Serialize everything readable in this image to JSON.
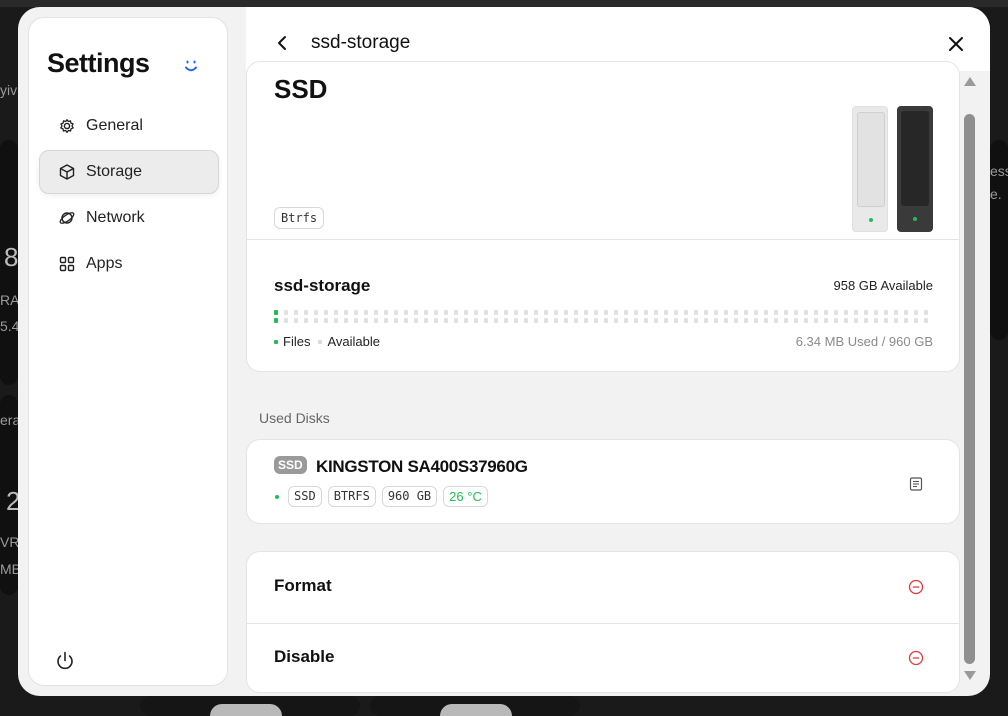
{
  "background": {
    "texts": [
      "yiv",
      "8",
      "RA",
      "5.4",
      "era",
      "2",
      "VRA",
      "MB",
      "ess",
      "e."
    ]
  },
  "sidebar": {
    "title": "Settings",
    "items": [
      {
        "label": "General",
        "icon": "gear-icon"
      },
      {
        "label": "Storage",
        "icon": "cube-icon",
        "active": true
      },
      {
        "label": "Network",
        "icon": "planet-icon"
      },
      {
        "label": "Apps",
        "icon": "grid-icon"
      }
    ]
  },
  "header": {
    "title": "ssd-storage"
  },
  "storage": {
    "device_type": "SSD",
    "filesystem": "Btrfs",
    "pool": {
      "name": "ssd-storage",
      "available": "958 GB Available",
      "used_summary": "6.34 MB Used / 960 GB",
      "used_fraction": 6.6e-06,
      "legend_files": "Files",
      "legend_available": "Available"
    }
  },
  "used_disks": {
    "label": "Used Disks",
    "disks": [
      {
        "tag": "SSD",
        "name": "KINGSTON SA400S37960G",
        "chips": [
          "SSD",
          "BTRFS",
          "960 GB"
        ],
        "temperature": "26 °C"
      }
    ]
  },
  "actions": [
    {
      "label": "Format"
    },
    {
      "label": "Disable"
    }
  ],
  "colors": {
    "accent_green": "#1fbf55",
    "danger_red": "#e03a3a",
    "brand_blue": "#1d63ff"
  }
}
